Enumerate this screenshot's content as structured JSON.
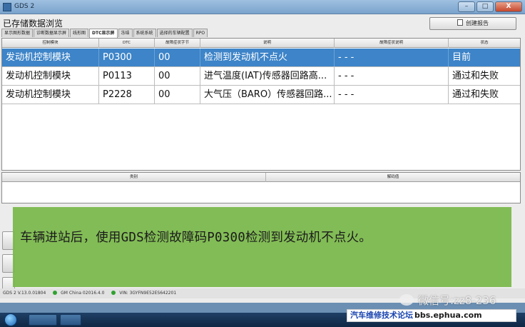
{
  "window": {
    "title": "GDS 2",
    "minimize_label": "–",
    "maximize_label": "□",
    "close_label": "X"
  },
  "page": {
    "title": "已存储数据浏览",
    "create_report_label": "创建报告"
  },
  "tabs": [
    {
      "label": "显示图形数据",
      "active": false
    },
    {
      "label": "诊断数据显示屏",
      "active": false
    },
    {
      "label": "线形图",
      "active": false
    },
    {
      "label": "DTC显示屏",
      "active": true
    },
    {
      "label": "冻结",
      "active": false
    },
    {
      "label": "系统系统",
      "active": false
    },
    {
      "label": "选择的车辆配置",
      "active": false
    },
    {
      "label": "RPO",
      "active": false
    }
  ],
  "dtc_table": {
    "columns": [
      "控制模块",
      "DTC",
      "故障症状字节",
      "说明",
      "故障症状说明",
      "状态"
    ],
    "rows": [
      {
        "module": "发动机控制模块",
        "dtc": "P0300",
        "symptom_byte": "00",
        "description": "检测到发动机不点火",
        "symptom_description": "- - -",
        "status": "目前",
        "selected": true
      },
      {
        "module": "发动机控制模块",
        "dtc": "P0113",
        "symptom_byte": "00",
        "description": "进气温度(IAT)传感器回路高...",
        "symptom_description": "- - -",
        "status": "通过和失败",
        "selected": false
      },
      {
        "module": "发动机控制模块",
        "dtc": "P2228",
        "symptom_byte": "00",
        "description": "大气压（BARO）传感器回路...",
        "symptom_description": "- - -",
        "status": "通过和失败",
        "selected": false
      }
    ]
  },
  "detail_table": {
    "columns": [
      "类别",
      "解码值"
    ]
  },
  "status_bar": {
    "version": "GDS 2 V.13.0.01804",
    "data": "GM China 02016.4.0",
    "vin": "VIN: 3GYFN9E52ES642201",
    "ok_color": "#2fa12f"
  },
  "caption": {
    "text": "车辆进站后，使用GDS检测故障码P0300检测到发动机不点火。",
    "background": "#7ab84a"
  },
  "watermark": {
    "wechat": "微信号:zz8-236",
    "forum_name": "汽车维修技术论坛",
    "forum_url": "bbs.ephua.com"
  },
  "icons": [
    "app-icon",
    "document-icon",
    "wechat-icon",
    "start-orb-icon",
    "status-ok-icon"
  ]
}
